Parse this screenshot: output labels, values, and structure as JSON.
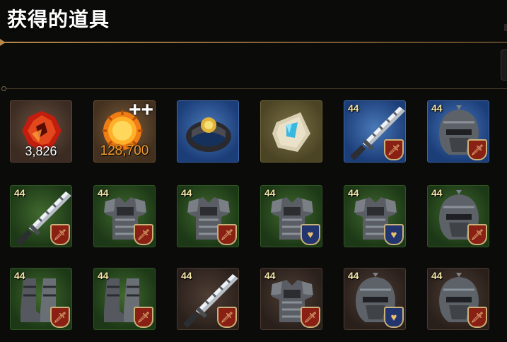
{
  "header": {
    "title": "获得的道具"
  },
  "items": [
    {
      "kind": "red-crystal-icon",
      "bg": "brown",
      "count": "3,826"
    },
    {
      "kind": "sun-coin-icon",
      "bg": "gold",
      "count": "128,700",
      "plus": "+"
    },
    {
      "kind": "ring-icon",
      "bg": "blue"
    },
    {
      "kind": "rune-stone-icon",
      "bg": "tan"
    },
    {
      "kind": "sword-icon",
      "bg": "blue",
      "level": "44",
      "badge": "attack"
    },
    {
      "kind": "helmet-icon",
      "bg": "blue",
      "level": "44",
      "badge": "attack"
    },
    {
      "kind": "sword-icon",
      "bg": "green",
      "level": "44",
      "badge": "attack"
    },
    {
      "kind": "armor-icon",
      "bg": "green",
      "level": "44",
      "badge": "attack"
    },
    {
      "kind": "armor-icon",
      "bg": "green",
      "level": "44",
      "badge": "attack"
    },
    {
      "kind": "armor-icon",
      "bg": "green",
      "level": "44",
      "badge": "defense"
    },
    {
      "kind": "armor-icon",
      "bg": "green",
      "level": "44",
      "badge": "defense"
    },
    {
      "kind": "helmet-icon",
      "bg": "green",
      "level": "44",
      "badge": "attack"
    },
    {
      "kind": "boots-icon",
      "bg": "green",
      "level": "44",
      "badge": "attack"
    },
    {
      "kind": "boots-icon",
      "bg": "green",
      "level": "44",
      "badge": "attack"
    },
    {
      "kind": "sword-icon",
      "bg": "dark",
      "level": "44",
      "badge": "attack"
    },
    {
      "kind": "armor-icon",
      "bg": "dark",
      "level": "44",
      "badge": "attack"
    },
    {
      "kind": "helmet-icon",
      "bg": "dark",
      "level": "44",
      "badge": "defense"
    },
    {
      "kind": "helmet-icon",
      "bg": "dark",
      "level": "44",
      "badge": "attack"
    }
  ],
  "colors": {
    "attack_badge": "#8a2014",
    "defense_badge": "#23356e",
    "level_text": "#f3e6a8",
    "gold_count": "#f49a2b"
  }
}
